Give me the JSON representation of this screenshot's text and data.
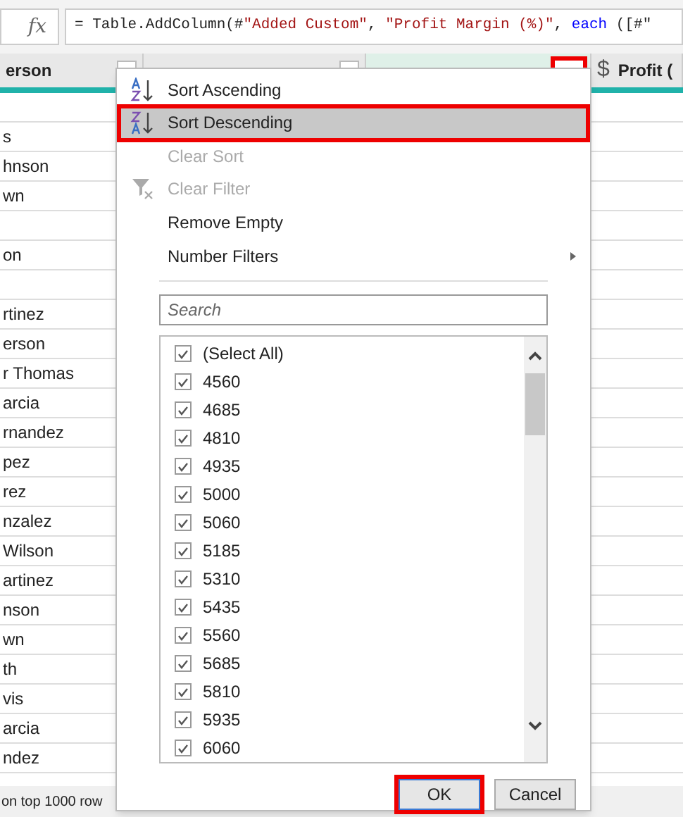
{
  "formula_bar": {
    "icon": "fx",
    "segments": [
      {
        "kind": "plain",
        "text": "= Table.AddColumn(#"
      },
      {
        "kind": "string",
        "text": "\"Added Custom\""
      },
      {
        "kind": "plain",
        "text": ", "
      },
      {
        "kind": "string",
        "text": "\"Profit Margin (%)\""
      },
      {
        "kind": "plain",
        "text": ", "
      },
      {
        "kind": "keyword",
        "text": "each"
      },
      {
        "kind": "plain",
        "text": " ([#\""
      }
    ]
  },
  "table": {
    "columns": [
      {
        "header": "erson",
        "highlighted": false
      },
      {
        "highlighted": false
      },
      {
        "highlighted": true
      },
      {
        "header": "Profit (",
        "currency": "$"
      }
    ],
    "rows": [
      "",
      "s",
      "hnson",
      "wn",
      "",
      "on",
      "",
      "rtinez",
      "erson",
      "r Thomas",
      "arcia",
      "rnandez",
      "pez",
      "rez",
      "nzalez",
      "Wilson",
      "artinez",
      "nson",
      "wn",
      "th",
      "vis",
      "arcia",
      "ndez"
    ]
  },
  "status_bar": {
    "text": "on top 1000 row"
  },
  "menu": {
    "items": [
      {
        "kind": "sort_asc",
        "label": "Sort Ascending",
        "disabled": false,
        "highlighted": false
      },
      {
        "kind": "sort_desc",
        "label": "Sort Descending",
        "disabled": false,
        "highlighted": true
      },
      {
        "kind": "plain",
        "label": "Clear Sort",
        "disabled": true,
        "highlighted": false
      },
      {
        "kind": "clear_filter",
        "label": "Clear Filter",
        "disabled": true,
        "highlighted": false
      },
      {
        "kind": "plain",
        "label": "Remove Empty",
        "disabled": false,
        "highlighted": false
      },
      {
        "kind": "submenu",
        "label": "Number Filters",
        "disabled": false,
        "highlighted": false
      }
    ],
    "search": {
      "placeholder": "Search"
    },
    "values": [
      {
        "label": "(Select All)",
        "checked": true
      },
      {
        "label": "4560",
        "checked": true
      },
      {
        "label": "4685",
        "checked": true
      },
      {
        "label": "4810",
        "checked": true
      },
      {
        "label": "4935",
        "checked": true
      },
      {
        "label": "5000",
        "checked": true
      },
      {
        "label": "5060",
        "checked": true
      },
      {
        "label": "5185",
        "checked": true
      },
      {
        "label": "5310",
        "checked": true
      },
      {
        "label": "5435",
        "checked": true
      },
      {
        "label": "5560",
        "checked": true
      },
      {
        "label": "5685",
        "checked": true
      },
      {
        "label": "5810",
        "checked": true
      },
      {
        "label": "5935",
        "checked": true
      },
      {
        "label": "6060",
        "checked": true
      }
    ],
    "buttons": [
      {
        "label": "OK",
        "highlighted": true
      },
      {
        "label": "Cancel",
        "highlighted": false
      }
    ]
  }
}
